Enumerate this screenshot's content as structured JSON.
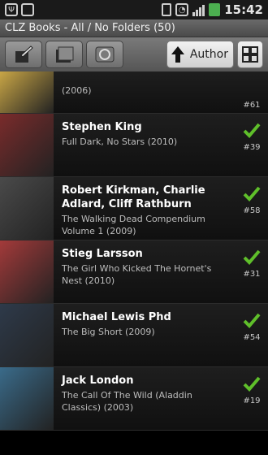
{
  "status": {
    "time": "15:42"
  },
  "titlebar": {
    "title": "CLZ Books - All / No Folders (50)"
  },
  "toolbar": {
    "sort_label": "Author"
  },
  "colors": {
    "check": "#5fbf2a",
    "accent": "#4caf50"
  },
  "books": [
    {
      "author": "",
      "title": "(2006)",
      "number": "#61",
      "cover": "#c9a646",
      "checked": false
    },
    {
      "author": "Stephen King",
      "title": "Full Dark, No Stars (2010)",
      "number": "#39",
      "cover": "#7a2b2b",
      "checked": true
    },
    {
      "author": "Robert Kirkman, Charlie Adlard, Cliff Rathburn",
      "title": "The Walking Dead Compendium Volume 1 (2009)",
      "number": "#58",
      "cover": "#4a4a4a",
      "checked": true
    },
    {
      "author": "Stieg Larsson",
      "title": "The Girl Who Kicked The Hornet's Nest (2010)",
      "number": "#31",
      "cover": "#a33a3a",
      "checked": true
    },
    {
      "author": "Michael Lewis Phd",
      "title": "The Big Short (2009)",
      "number": "#54",
      "cover": "#2e3a4a",
      "checked": true
    },
    {
      "author": "Jack London",
      "title": "The Call Of The Wild (Aladdin Classics) (2003)",
      "number": "#19",
      "cover": "#3a6b8a",
      "checked": true
    }
  ]
}
